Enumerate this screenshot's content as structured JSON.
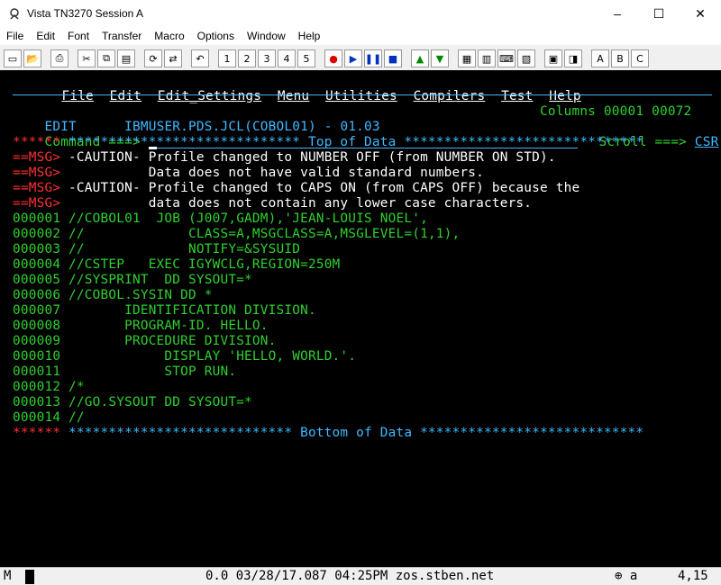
{
  "window": {
    "title": "Vista TN3270 Session A",
    "minimize": "–",
    "maximize": "☐",
    "close": "✕"
  },
  "menubar": [
    "File",
    "Edit",
    "Font",
    "Transfer",
    "Macro",
    "Options",
    "Window",
    "Help"
  ],
  "toolbar": {
    "icons": [
      "new-icon",
      "open-icon",
      "print-icon",
      "cut-icon",
      "copy-icon",
      "paste-icon",
      "refresh-icon",
      "transfer-icon",
      "undo-icon"
    ],
    "macro_labels": [
      "1",
      "2",
      "3",
      "4",
      "5"
    ],
    "ab_labels": [
      "A",
      "B",
      "C"
    ]
  },
  "ispf": {
    "menu": [
      "File",
      "Edit",
      "Edit_Settings",
      "Menu",
      "Utilities",
      "Compilers",
      "Test",
      "Help"
    ],
    "mode": "EDIT",
    "dataset": "IBMUSER.PDS.JCL(COBOL01) - 01.03",
    "columns": "Columns 00001 00072",
    "command_label": "Command ===>",
    "scroll_label": "Scroll ===>",
    "scroll_value": "CSR",
    "top_marker": "******",
    "top_text": " ***************************** Top of Data ******************************",
    "msgs": [
      {
        "tag": "==MSG>",
        "text": " -CAUTION- Profile changed to NUMBER OFF (from NUMBER ON STD)."
      },
      {
        "tag": "==MSG>",
        "text": "           Data does not have valid standard numbers."
      },
      {
        "tag": "==MSG>",
        "text": " -CAUTION- Profile changed to CAPS ON (from CAPS OFF) because the"
      },
      {
        "tag": "==MSG>",
        "text": "           data does not contain any lower case characters."
      }
    ],
    "lines": [
      {
        "num": "000001",
        "text": " //COBOL01  JOB (J007,GADM),'JEAN-LOUIS NOEL',"
      },
      {
        "num": "000002",
        "text": " //             CLASS=A,MSGCLASS=A,MSGLEVEL=(1,1),"
      },
      {
        "num": "000003",
        "text": " //             NOTIFY=&SYSUID"
      },
      {
        "num": "000004",
        "text": " //CSTEP   EXEC IGYWCLG,REGION=250M"
      },
      {
        "num": "000005",
        "text": " //SYSPRINT  DD SYSOUT=*"
      },
      {
        "num": "000006",
        "text": " //COBOL.SYSIN DD *"
      },
      {
        "num": "000007",
        "text": "        IDENTIFICATION DIVISION."
      },
      {
        "num": "000008",
        "text": "        PROGRAM-ID. HELLO."
      },
      {
        "num": "000009",
        "text": "        PROCEDURE DIVISION."
      },
      {
        "num": "000010",
        "text": "             DISPLAY 'HELLO, WORLD.'."
      },
      {
        "num": "000011",
        "text": "             STOP RUN."
      },
      {
        "num": "000012",
        "text": " /*"
      },
      {
        "num": "000013",
        "text": " //GO.SYSOUT DD SYSOUT=*"
      },
      {
        "num": "000014",
        "text": " //"
      }
    ],
    "bottom_marker": "******",
    "bottom_text": " **************************** Bottom of Data ****************************"
  },
  "status": {
    "mode": "M",
    "info": "0.0 03/28/17.087 04:25PM zos.stben.net",
    "indicator": "a",
    "position": "4,15"
  }
}
